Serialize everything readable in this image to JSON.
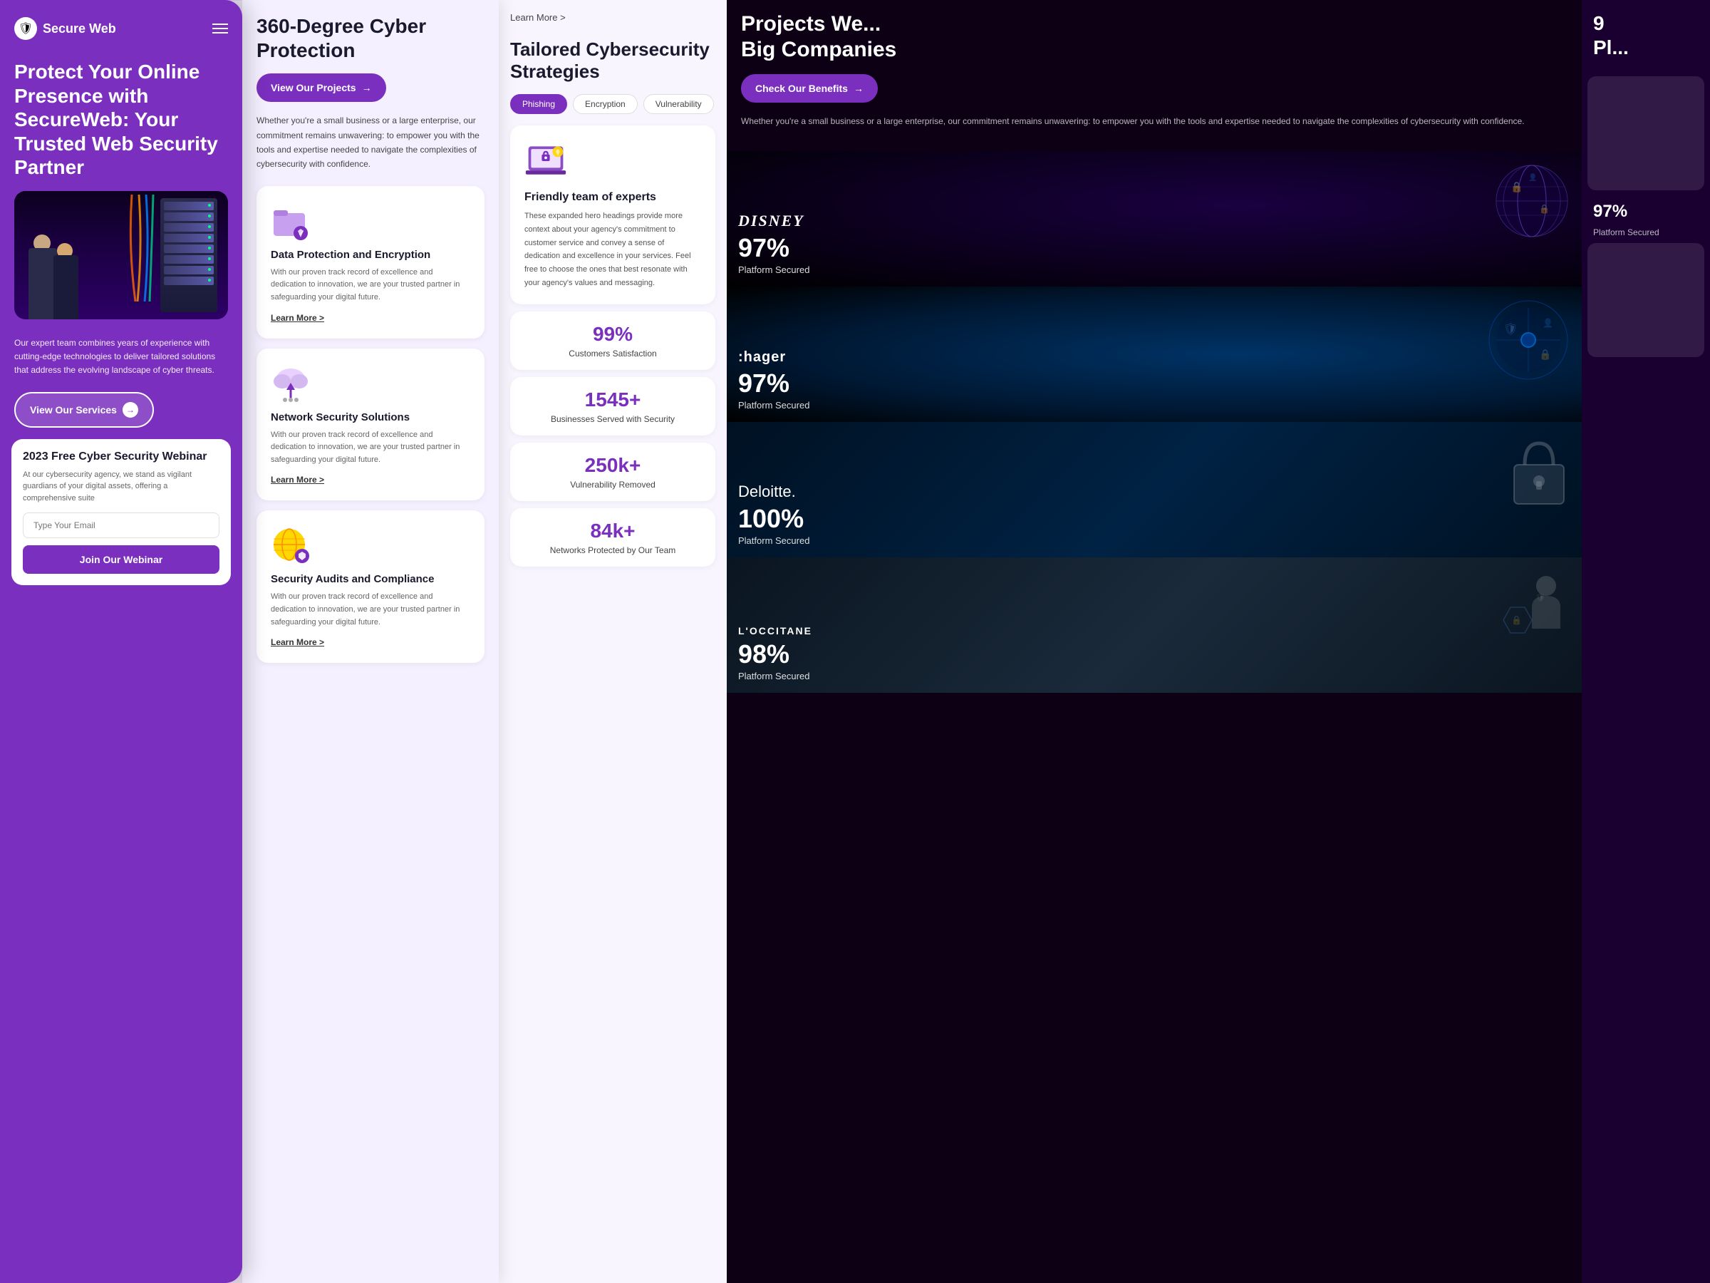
{
  "app": {
    "name": "Secure Web",
    "logo_symbol": "🛡"
  },
  "panel1": {
    "logo_text": "Secure Web",
    "hero_title": "Protect Your Online Presence with SecureWeb: Your Trusted Web Security Partner",
    "description": "Our expert team combines years of experience with cutting-edge technologies to deliver tailored solutions that address the evolving landscape of cyber threats.",
    "cta_button": "View Our Services",
    "webinar": {
      "title": "2023 Free Cyber Security Webinar",
      "description": "At our cybersecurity agency, we stand as vigilant guardians of your digital assets, offering a comprehensive suite",
      "email_placeholder": "Type Your Email",
      "join_button": "Join Our Webinar"
    }
  },
  "panel2": {
    "title": "360-Degree Cyber Protection",
    "view_projects_btn": "View Our Projects",
    "description": "Whether you're a small business or a large enterprise, our commitment remains unwavering: to empower you with the tools and expertise needed to navigate the complexities of cybersecurity with confidence.",
    "services": [
      {
        "title": "Data Protection and Encryption",
        "description": "With our proven track record of excellence and dedication to innovation, we are your trusted partner in safeguarding your digital future.",
        "learn_more": "Learn More >"
      },
      {
        "title": "Network Security Solutions",
        "description": "With our proven track record of excellence and dedication to innovation, we are your trusted partner in safeguarding your digital future.",
        "learn_more": "Learn More >"
      },
      {
        "title": "Security Audits and Compliance",
        "description": "With our proven track record of excellence and dedication to innovation, we are your trusted partner in safeguarding your digital future.",
        "learn_more": "Learn More >"
      }
    ]
  },
  "panel3": {
    "top_link": "Learn More >",
    "title": "Tailored Cybersecurity Strategies",
    "tabs": [
      "Phishing",
      "Encryption",
      "Vulnerability"
    ],
    "active_tab": "Phishing",
    "strategy": {
      "title": "Friendly team of experts",
      "description": "These expanded hero headings provide more context about your agency's commitment to customer service and convey a sense of dedication and excellence in your services. Feel free to choose the ones that best resonate with your agency's values and messaging."
    },
    "stats": [
      {
        "number": "99%",
        "label": "Customers Satisfaction"
      },
      {
        "number": "1545+",
        "label": "Businesses Served  with Security"
      },
      {
        "number": "250k+",
        "label": "Vulnerability Removed"
      },
      {
        "number": "84k+",
        "label": "Networks Protected  by Our Team"
      }
    ]
  },
  "panel4": {
    "title": "Projects We... Big Companies",
    "check_benefits_btn": "Check Our Benefits",
    "description": "Whether you're a small business or a large enterprise, our commitment remains unwavering: to empower you with the tools and expertise needed to navigate the complexities of cybersecurity with confidence.",
    "projects": [
      {
        "company": "Disney",
        "percent": "97%",
        "label": "Platform Secured",
        "company_display": "DISNEY"
      },
      {
        "company": "Hager",
        "percent": "97%",
        "label": "Platform Secured",
        "company_display": ":hager"
      },
      {
        "company": "Deloitte",
        "percent": "100%",
        "label": "Platform Secured",
        "company_display": "Deloitte."
      },
      {
        "company": "LOccitane",
        "percent": "98%",
        "label": "Platform Secured",
        "company_display": "L'OCCITANE"
      }
    ]
  },
  "panel5": {
    "peek_text": "9\nPl..."
  }
}
